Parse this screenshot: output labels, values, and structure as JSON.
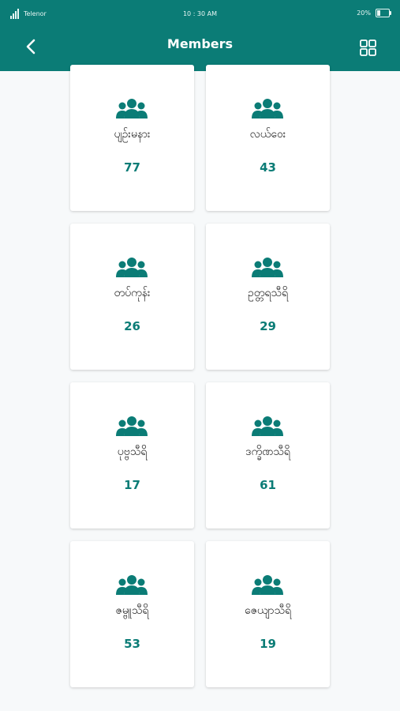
{
  "status_bar": {
    "carrier": "Telenor",
    "time": "10 : 30 AM",
    "battery": "20%"
  },
  "header": {
    "title": "Members",
    "back_icon": "chevron-left-icon",
    "view_icon": "grid-icon"
  },
  "colors": {
    "primary": "#0b7c76",
    "background": "#f7f9fa",
    "card": "#ffffff"
  },
  "cards": [
    {
      "name": "ပျဉ်းမနား",
      "count": "77",
      "icon": "group-icon"
    },
    {
      "name": "လယ်ဝေး",
      "count": "43",
      "icon": "group-icon"
    },
    {
      "name": "တပ်ကုန်း",
      "count": "26",
      "icon": "group-icon"
    },
    {
      "name": "ဥတ္တရသီရိ",
      "count": "29",
      "icon": "group-icon"
    },
    {
      "name": "ပုဗ္ဗသီရိ",
      "count": "17",
      "icon": "group-icon"
    },
    {
      "name": "ဒက္ခိဏသီရိ",
      "count": "61",
      "icon": "group-icon"
    },
    {
      "name": "ဇမ္ဗူသီရိ",
      "count": "53",
      "icon": "group-icon"
    },
    {
      "name": "ဇေယျာသီရိ",
      "count": "19",
      "icon": "group-icon"
    }
  ]
}
